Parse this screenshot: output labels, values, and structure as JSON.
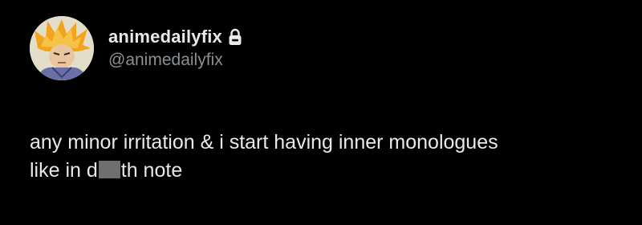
{
  "author": {
    "display_name": "animedailyfix",
    "handle": "@animedailyfix",
    "avatar_icon": "anime-character-avatar",
    "protected_icon": "lock-icon"
  },
  "tweet": {
    "line1": "any minor irritation & i start having inner monologues",
    "line2_before": "like in d",
    "line2_after": "th note"
  },
  "colors": {
    "background": "#000000",
    "text": "#e7e9ea",
    "secondary_text": "#8b9095",
    "censor_box": "#6f6f6f"
  }
}
